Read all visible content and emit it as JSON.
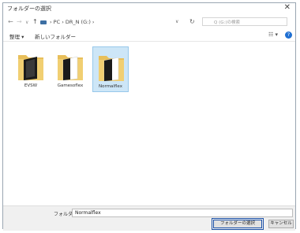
{
  "window": {
    "title": "フォルダーの選択",
    "close_glyph": "✕"
  },
  "address_bar": {
    "back_glyph": "←",
    "forward_glyph": "→",
    "recent_glyph": "∨",
    "up_glyph": "↑",
    "path": "›  PC  ›  DR_N (G:)  ›",
    "dropdown_glyph": "∨",
    "refresh_glyph": "↻",
    "search_placeholder": "Q (G:)の検索"
  },
  "toolbar": {
    "organize": "整理 ▾",
    "new_folder": "新しいフォルダー",
    "view_glyph": "☷ ▾",
    "help_glyph": "?"
  },
  "folders": [
    {
      "name": "EVSW",
      "selected": false
    },
    {
      "name": "Gamesoflex",
      "selected": false
    },
    {
      "name": "Normalflex",
      "selected": true
    }
  ],
  "footer": {
    "folder_label": "フォルダー:",
    "folder_value": "Normalflex",
    "select_button": "フォルダーの選択",
    "cancel_button": "キャンセル"
  },
  "colors": {
    "folder": "#e8bf5a",
    "folder_dark": "#c99a35",
    "selection_bg": "#cde6f7",
    "primary_border": "#1d52a8"
  }
}
